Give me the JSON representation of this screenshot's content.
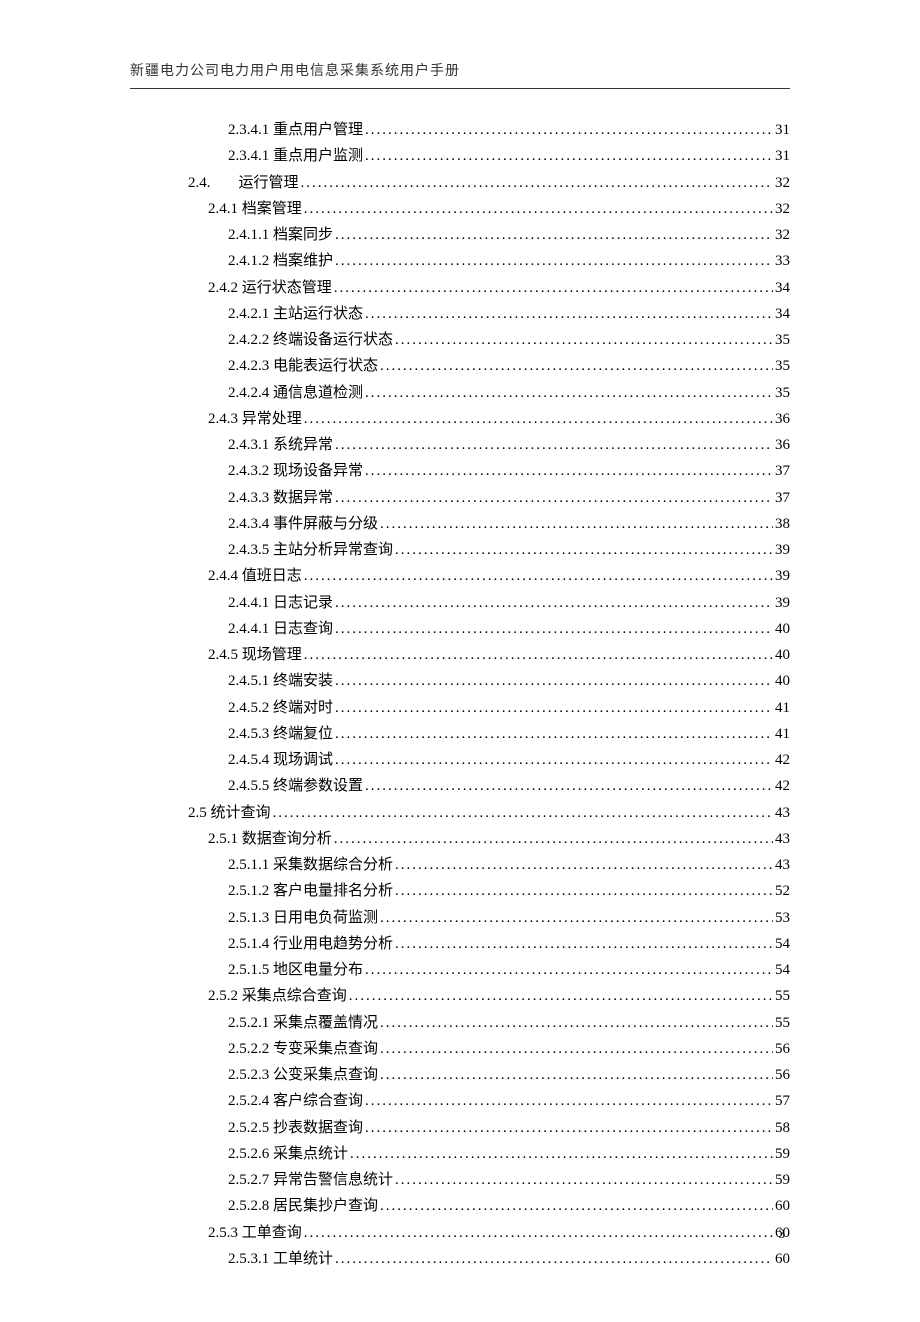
{
  "header": "新疆电力公司电力用户用电信息采集系统用户手册",
  "page_number": "3",
  "toc": [
    {
      "level": 3,
      "label": "2.3.4.1 重点用户管理",
      "page": "31"
    },
    {
      "level": 3,
      "label": "2.3.4.1 重点用户监测",
      "page": "31"
    },
    {
      "level": "24",
      "num": "2.4.",
      "label": "运行管理",
      "page": "32"
    },
    {
      "level": 2,
      "label": "2.4.1 档案管理",
      "page": "32"
    },
    {
      "level": 3,
      "label": "2.4.1.1 档案同步",
      "page": "32"
    },
    {
      "level": 3,
      "label": "2.4.1.2 档案维护",
      "page": "33"
    },
    {
      "level": 2,
      "label": "2.4.2 运行状态管理",
      "page": "34"
    },
    {
      "level": 3,
      "label": "2.4.2.1 主站运行状态",
      "page": "34"
    },
    {
      "level": 3,
      "label": "2.4.2.2 终端设备运行状态",
      "page": "35"
    },
    {
      "level": 3,
      "label": "2.4.2.3 电能表运行状态",
      "page": "35"
    },
    {
      "level": 3,
      "label": "2.4.2.4 通信息道检测",
      "page": "35"
    },
    {
      "level": 2,
      "label": "2.4.3 异常处理",
      "page": "36"
    },
    {
      "level": 3,
      "label": "2.4.3.1 系统异常",
      "page": "36"
    },
    {
      "level": 3,
      "label": "2.4.3.2 现场设备异常",
      "page": "37"
    },
    {
      "level": 3,
      "label": "2.4.3.3 数据异常",
      "page": "37"
    },
    {
      "level": 3,
      "label": "2.4.3.4 事件屏蔽与分级",
      "page": "38"
    },
    {
      "level": 3,
      "label": "2.4.3.5 主站分析异常查询",
      "page": "39"
    },
    {
      "level": 2,
      "label": "2.4.4 值班日志",
      "page": "39"
    },
    {
      "level": 3,
      "label": "2.4.4.1 日志记录",
      "page": "39"
    },
    {
      "level": 3,
      "label": "2.4.4.1 日志查询",
      "page": "40"
    },
    {
      "level": 2,
      "label": "2.4.5 现场管理",
      "page": "40"
    },
    {
      "level": 3,
      "label": "2.4.5.1 终端安装",
      "page": "40"
    },
    {
      "level": 3,
      "label": "2.4.5.2 终端对时",
      "page": "41"
    },
    {
      "level": 3,
      "label": "2.4.5.3 终端复位",
      "page": "41"
    },
    {
      "level": 3,
      "label": "2.4.5.4 现场调试",
      "page": "42"
    },
    {
      "level": 3,
      "label": "2.4.5.5 终端参数设置",
      "page": "42"
    },
    {
      "level": 1,
      "label": "2.5 统计查询",
      "page": "43"
    },
    {
      "level": 2,
      "label": "2.5.1 数据查询分析",
      "page": "43"
    },
    {
      "level": 3,
      "label": "2.5.1.1 采集数据综合分析",
      "page": "43"
    },
    {
      "level": 3,
      "label": "2.5.1.2  客户电量排名分析",
      "page": "52"
    },
    {
      "level": 3,
      "label": "2.5.1.3 日用电负荷监测",
      "page": "53"
    },
    {
      "level": 3,
      "label": "2.5.1.4 行业用电趋势分析",
      "page": "54"
    },
    {
      "level": 3,
      "label": "2.5.1.5 地区电量分布",
      "page": "54"
    },
    {
      "level": 2,
      "label": "2.5.2  采集点综合查询",
      "page": "55"
    },
    {
      "level": 3,
      "label": "2.5.2.1 采集点覆盖情况",
      "page": "55"
    },
    {
      "level": 3,
      "label": "2.5.2.2 专变采集点查询",
      "page": "56"
    },
    {
      "level": 3,
      "label": "2.5.2.3 公变采集点查询",
      "page": "56"
    },
    {
      "level": 3,
      "label": "2.5.2.4 客户综合查询",
      "page": "57"
    },
    {
      "level": 3,
      "label": "2.5.2.5 抄表数据查询",
      "page": "58"
    },
    {
      "level": 3,
      "label": "2.5.2.6 采集点统计",
      "page": "59"
    },
    {
      "level": 3,
      "label": "2.5.2.7  异常告警信息统计",
      "page": "59"
    },
    {
      "level": 3,
      "label": "2.5.2.8 居民集抄户查询",
      "page": "60"
    },
    {
      "level": 2,
      "label": "2.5.3 工单查询",
      "page": "60"
    },
    {
      "level": 3,
      "label": "2.5.3.1 工单统计",
      "page": "60"
    }
  ]
}
